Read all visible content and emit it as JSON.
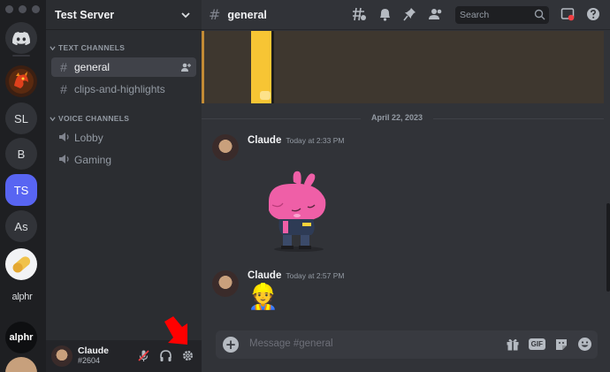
{
  "colors": {
    "accent": "#5865f2",
    "rail_bg": "#1e1f22",
    "sidebar_bg": "#2b2d31",
    "main_bg": "#313338",
    "annotation_arrow": "#ff0000"
  },
  "servers": [
    {
      "name": "home",
      "icon": "discord-icon"
    },
    {
      "name": "dragon-server",
      "icon": "dragon-avatar"
    },
    {
      "label": "SL"
    },
    {
      "label": "B"
    },
    {
      "label": "TS",
      "active": true
    },
    {
      "label": "As"
    },
    {
      "name": "pill-server",
      "icon": "pill-avatar"
    },
    {
      "label": "alphr"
    },
    {
      "label": "alphr"
    }
  ],
  "sidebar": {
    "server_name": "Test Server",
    "text_category": "TEXT CHANNELS",
    "voice_category": "VOICE CHANNELS",
    "text_channels": [
      "general",
      "clips-and-highlights"
    ],
    "voice_channels": [
      "Lobby",
      "Gaming"
    ],
    "user": {
      "name": "Claude",
      "tag": "#2604"
    }
  },
  "header": {
    "channel": "general",
    "search_placeholder": "Search"
  },
  "messages": {
    "date": "April 22, 2023",
    "items": [
      {
        "author": "Claude",
        "time": "Today at 2:33 PM",
        "content": "pink-bunny-sticker"
      },
      {
        "author": "Claude",
        "time": "Today at 2:57 PM",
        "content": "👷"
      }
    ]
  },
  "composer": {
    "placeholder": "Message #general",
    "gif_label": "GIF"
  }
}
